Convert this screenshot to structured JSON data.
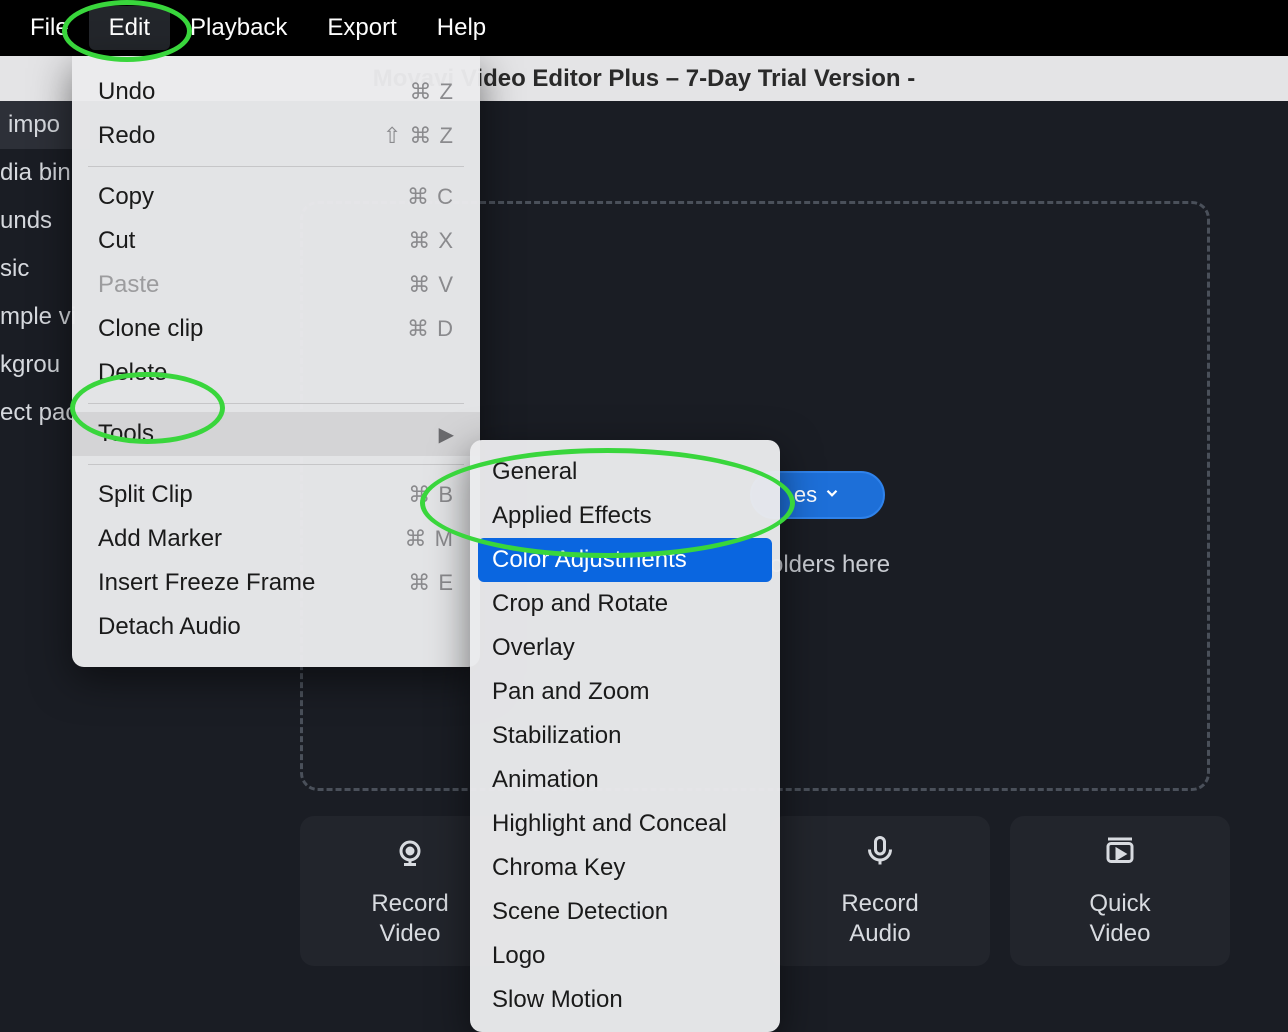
{
  "menubar": {
    "items": [
      "File",
      "Edit",
      "Playback",
      "Export",
      "Help"
    ],
    "open_index": 1
  },
  "titlebar": "Movavi Video Editor Plus – 7-Day Trial Version -",
  "sidebar": {
    "items": [
      "impo",
      "dia bin",
      "unds",
      "sic",
      "mple vi",
      "kgrou",
      "ect pac"
    ],
    "active_index": 0
  },
  "add_button": {
    "label": "es"
  },
  "drop_text": "olders here",
  "tools": [
    {
      "name": "record-video",
      "label": "Record\nVideo",
      "icon": "camera"
    },
    {
      "name": "record-audio",
      "label": "Record\nAudio",
      "icon": "mic"
    },
    {
      "name": "quick-video",
      "label": "Quick\nVideo",
      "icon": "quick"
    }
  ],
  "edit_menu": {
    "groups": [
      [
        {
          "label": "Undo",
          "shortcut": "⌘ Z"
        },
        {
          "label": "Redo",
          "shortcut": "⇧ ⌘ Z"
        }
      ],
      [
        {
          "label": "Copy",
          "shortcut": "⌘ C"
        },
        {
          "label": "Cut",
          "shortcut": "⌘ X"
        },
        {
          "label": "Paste",
          "shortcut": "⌘ V",
          "disabled": true
        },
        {
          "label": "Clone clip",
          "shortcut": "⌘ D"
        },
        {
          "label": "Delete",
          "shortcut": ""
        }
      ],
      [
        {
          "label": "Tools",
          "shortcut": "",
          "submenu": true,
          "hover": true
        }
      ],
      [
        {
          "label": "Split Clip",
          "shortcut": "⌘ B"
        },
        {
          "label": "Add Marker",
          "shortcut": "⌘ M"
        },
        {
          "label": "Insert Freeze Frame",
          "shortcut": "⌘ E"
        },
        {
          "label": "Detach Audio",
          "shortcut": ""
        }
      ]
    ]
  },
  "tools_submenu": {
    "items": [
      "General",
      "Applied Effects",
      "Color Adjustments",
      "Crop and Rotate",
      "Overlay",
      "Pan and Zoom",
      "Stabilization",
      "Animation",
      "Highlight and Conceal",
      "Chroma Key",
      "Scene Detection",
      "Logo",
      "Slow Motion"
    ],
    "selected_index": 2
  }
}
